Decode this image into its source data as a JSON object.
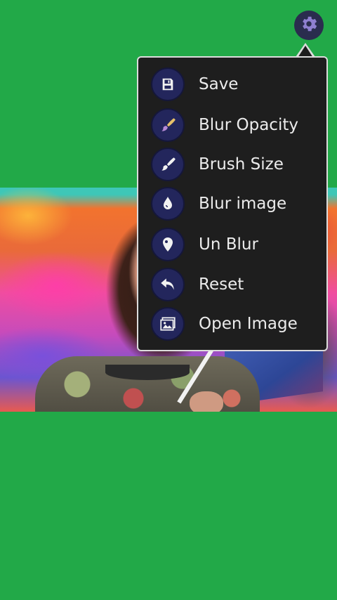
{
  "menu": {
    "items": [
      {
        "label": "Save",
        "icon": "save-icon"
      },
      {
        "label": "Blur Opacity",
        "icon": "paintbrush-opacity-icon"
      },
      {
        "label": "Brush Size",
        "icon": "paintbrush-icon"
      },
      {
        "label": "Blur image",
        "icon": "droplet-icon"
      },
      {
        "label": "Un Blur",
        "icon": "map-pin-icon"
      },
      {
        "label": "Reset",
        "icon": "undo-arrow-icon"
      },
      {
        "label": "Open Image",
        "icon": "gallery-icon"
      }
    ]
  },
  "colors": {
    "background": "#22a948",
    "menu_bg": "#1e1e1e",
    "icon_circle": "#23265c",
    "settings_button": "#2a2c4e",
    "gear": "#8f7fd0"
  }
}
